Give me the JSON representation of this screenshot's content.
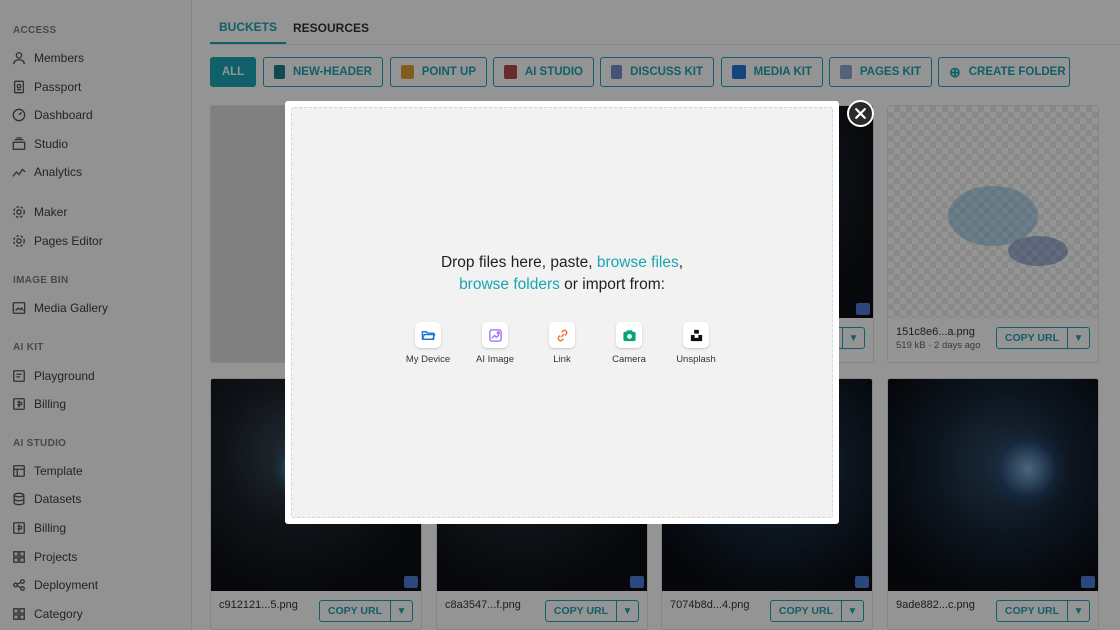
{
  "sidebar": {
    "sections": [
      {
        "title": "ACCESS",
        "items": [
          {
            "label": "Members",
            "icon": "user-icon"
          },
          {
            "label": "Passport",
            "icon": "passport-icon"
          },
          {
            "label": "Dashboard",
            "icon": "gauge-icon"
          },
          {
            "label": "Studio",
            "icon": "studio-icon"
          },
          {
            "label": "Analytics",
            "icon": "analytics-icon"
          },
          {
            "label": "Maker",
            "icon": "gear-icon"
          },
          {
            "label": "Pages Editor",
            "icon": "gear-icon"
          }
        ]
      },
      {
        "title": "IMAGE BIN",
        "items": [
          {
            "label": "Media Gallery",
            "icon": "gallery-icon"
          }
        ]
      },
      {
        "title": "AI KIT",
        "items": [
          {
            "label": "Playground",
            "icon": "playground-icon"
          },
          {
            "label": "Billing",
            "icon": "billing-icon"
          }
        ]
      },
      {
        "title": "AI STUDIO",
        "items": [
          {
            "label": "Template",
            "icon": "template-icon"
          },
          {
            "label": "Datasets",
            "icon": "database-icon"
          },
          {
            "label": "Billing",
            "icon": "billing-icon"
          },
          {
            "label": "Projects",
            "icon": "grid-icon"
          },
          {
            "label": "Deployment",
            "icon": "share-icon"
          },
          {
            "label": "Category",
            "icon": "grid-icon"
          }
        ]
      }
    ]
  },
  "tabs": [
    {
      "label": "BUCKETS",
      "active": true
    },
    {
      "label": "RESOURCES",
      "active": false
    }
  ],
  "filters": [
    {
      "label": "ALL",
      "active": true
    },
    {
      "label": "NEW-HEADER",
      "icon": "folder-icon"
    },
    {
      "label": "POINT UP",
      "icon": "pointup-icon"
    },
    {
      "label": "AI STUDIO",
      "icon": "aistudio-icon"
    },
    {
      "label": "DISCUSS KIT",
      "icon": "discusskit-icon"
    },
    {
      "label": "MEDIA KIT",
      "icon": "mediakit-icon"
    },
    {
      "label": "PAGES KIT",
      "icon": "pageskit-icon"
    },
    {
      "label": "CREATE FOLDER",
      "icon": "plus-circle-icon"
    }
  ],
  "cards": [
    {
      "name": "",
      "meta": ""
    },
    {
      "name": "",
      "meta": ""
    },
    {
      "name": "",
      "meta": ""
    },
    {
      "name": "151c8e6...a.png",
      "meta": "519 kB · 2 days ago"
    },
    {
      "name": "c912121...5.png",
      "meta": ""
    },
    {
      "name": "c8a3547...f.png",
      "meta": ""
    },
    {
      "name": "7074b8d...4.png",
      "meta": ""
    },
    {
      "name": "9ade882...c.png",
      "meta": ""
    }
  ],
  "copy_label": "COPY URL",
  "upload": {
    "line1_prefix": "Drop files here, paste, ",
    "browse_files": "browse files",
    "comma": ",",
    "browse_folders": "browse folders",
    "line2_suffix": " or import from:",
    "sources": [
      {
        "label": "My Device",
        "icon": "folder-open-icon",
        "color": "#2275d7"
      },
      {
        "label": "AI Image",
        "icon": "ai-image-icon",
        "color": "#9b6cf0"
      },
      {
        "label": "Link",
        "icon": "link-icon",
        "color": "#f0763a"
      },
      {
        "label": "Camera",
        "icon": "camera-icon",
        "color": "#03a678"
      },
      {
        "label": "Unsplash",
        "icon": "unsplash-icon",
        "color": "#111111"
      }
    ]
  },
  "colors": {
    "accent": "#1aa5b3"
  }
}
